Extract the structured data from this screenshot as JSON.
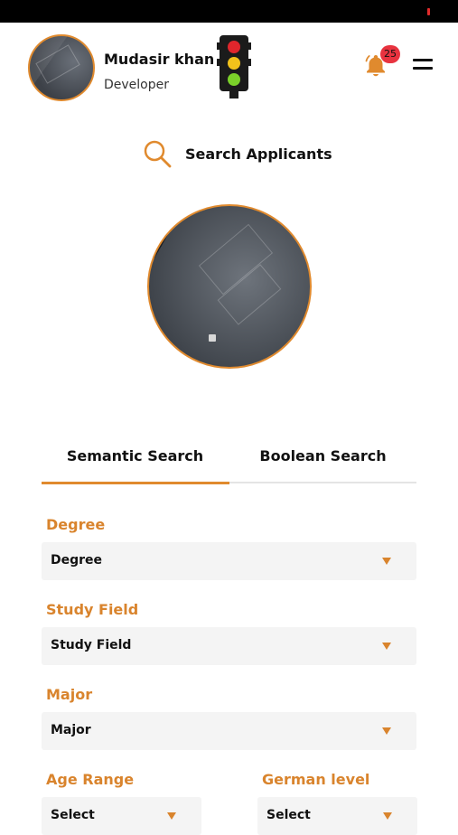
{
  "header": {
    "user_name": "Mudasir khan",
    "user_role": "Developer",
    "notification_count": "25"
  },
  "search": {
    "label": "Search Applicants"
  },
  "tabs": [
    {
      "label": "Semantic Search",
      "active": true
    },
    {
      "label": "Boolean Search",
      "active": false
    }
  ],
  "form": {
    "degree": {
      "label": "Degree",
      "value": "Degree"
    },
    "study_field": {
      "label": "Study Field",
      "value": "Study Field"
    },
    "major": {
      "label": "Major",
      "value": "Major"
    },
    "age_range": {
      "label": "Age Range",
      "value": "Select"
    },
    "german_level": {
      "label": "German level",
      "value": "Select"
    }
  },
  "colors": {
    "accent": "#e08a2e",
    "badge": "#e8333f",
    "select_bg": "#f4f4f4"
  },
  "icons": {
    "traffic": "traffic-light-icon",
    "bell": "bell-icon",
    "menu": "menu-icon",
    "search": "search-icon",
    "dropdown": "chevron-down-icon"
  }
}
